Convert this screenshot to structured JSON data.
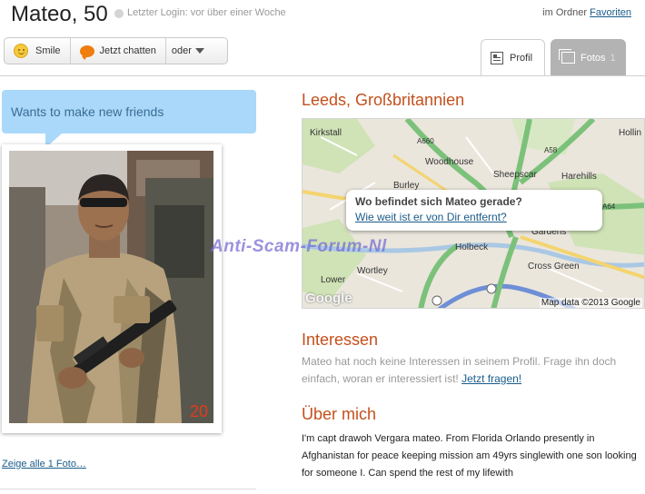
{
  "header": {
    "name_age": "Mateo, 50",
    "last_login": "Letzter Login: vor über einer Woche",
    "folder_prefix": "im Ordner",
    "folder_link": "Favoriten"
  },
  "actions": {
    "smile": "Smile",
    "chat": "Jetzt chatten",
    "more": "oder"
  },
  "tabs": [
    {
      "label": "Profil",
      "icon": "document-icon",
      "active": true
    },
    {
      "label": "Fotos",
      "count": "1",
      "icon": "photos-icon",
      "active": false
    }
  ],
  "status_bubble": "Wants to make new friends",
  "photo": {
    "alt": "Profile photo of man in military uniform holding a rifle",
    "overlay_text": "20"
  },
  "show_all_photos": "Zeige alle 1 Foto…",
  "location": {
    "title": "Leeds, Großbritannien",
    "popup_question": "Wo befindet sich Mateo gerade?",
    "popup_link": "Wie weit ist er von Dir entfernt?",
    "map_credit": "Map data ©2013 Google",
    "map_logo": "Google",
    "map_labels": [
      "Kirkstall",
      "Woodhouse",
      "Sheepscar",
      "Harehills",
      "Hollin",
      "Burley",
      "Holbeck",
      "Wortley",
      "Cross Green",
      "Lower",
      "Gardens",
      "A660",
      "A58",
      "A64"
    ]
  },
  "interests": {
    "title": "Interessen",
    "text": "Mateo hat noch keine Interessen in seinem Profil. Frage ihn doch einfach, woran er interessiert ist!",
    "link": "Jetzt fragen!"
  },
  "about": {
    "title": "Über mich",
    "text": "I'm capt drawoh Vergara mateo. From Florida Orlando presently in Afghanistan for peace keeping mission am 49yrs singlewith one son looking for someone I. Can spend the rest of my lifewith"
  },
  "watermark": "Anti-Scam-Forum-Nl"
}
